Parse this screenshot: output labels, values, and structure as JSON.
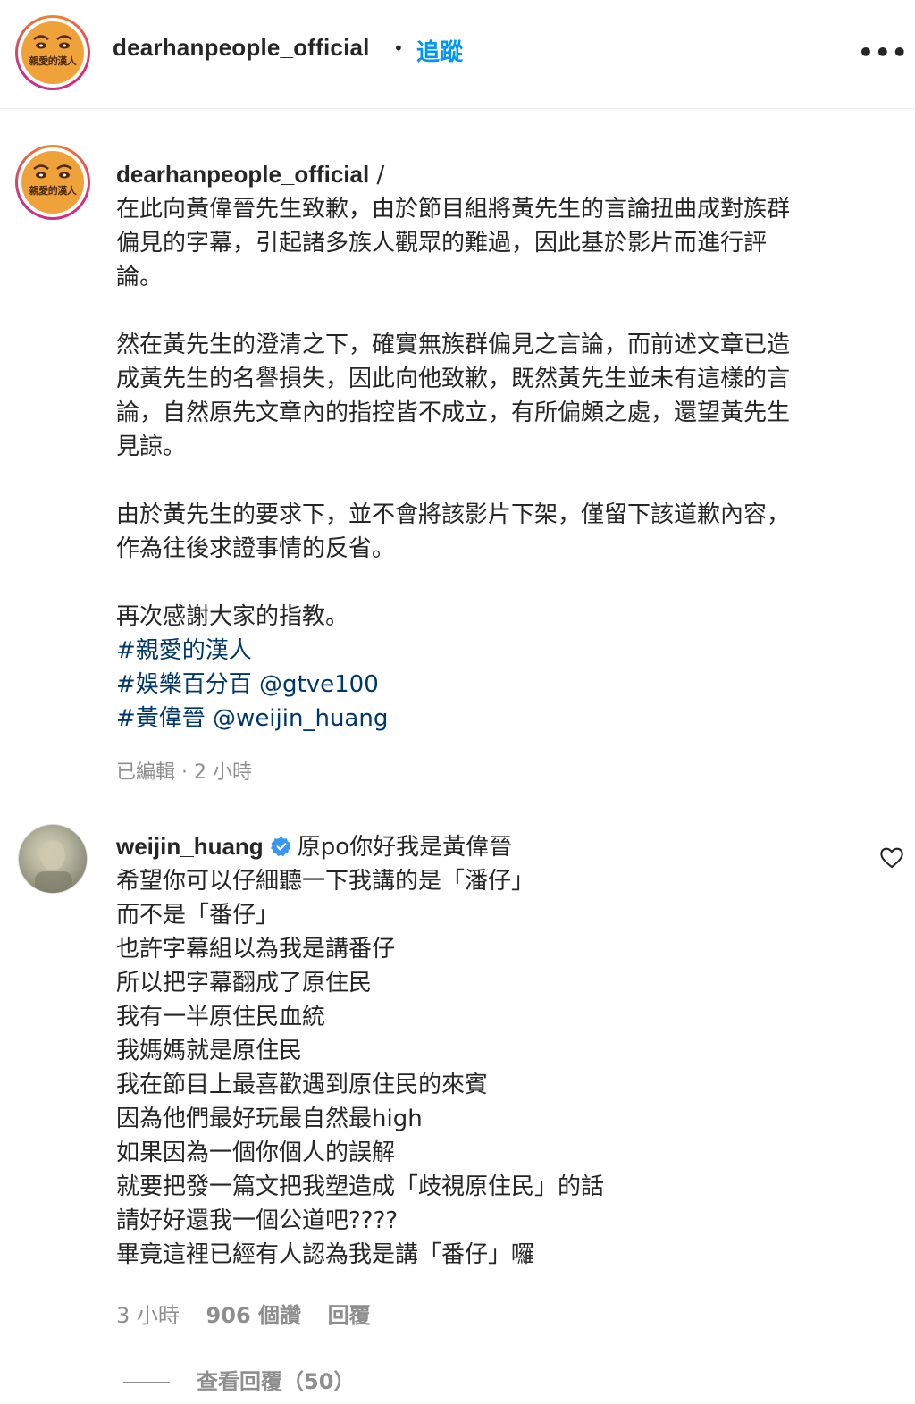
{
  "header": {
    "username": "dearhanpeople_official",
    "separator": "•",
    "follow_label": "追蹤",
    "more_label": "•••",
    "avatar_logo_text": "親愛的漢人"
  },
  "post": {
    "username": "dearhanpeople_official",
    "username_suffix": " /",
    "lines": [
      "在此向黃偉晉先生致歉，由於節目組將黃先生的言論扭曲成對族群",
      "偏見的字幕，引起諸多族人觀眾的難過，因此基於影片而進行評",
      "論。",
      "",
      "然在黃先生的澄清之下，確實無族群偏見之言論，而前述文章已造",
      "成黃先生的名譽損失，因此向他致歉，既然黃先生並未有這樣的言",
      "論，自然原先文章內的指控皆不成立，有所偏頗之處，還望黃先生",
      "見諒。",
      "",
      "由於黃先生的要求下，並不會將該影片下架，僅留下該道歉內容，",
      "作為往後求證事情的反省。",
      "",
      "再次感謝大家的指教。"
    ],
    "hashtags": [
      "#親愛的漢人",
      "#娛樂百分百 @gtve100",
      "#黃偉晉 @weijin_huang"
    ],
    "meta": "已編輯 · 2 小時"
  },
  "comment": {
    "username": "weijin_huang",
    "first_line": "原po你好我是黃偉晉",
    "lines": [
      "希望你可以仔細聽一下我講的是「潘仔」",
      "而不是「番仔」",
      "也許字幕組以為我是講番仔",
      "所以把字幕翻成了原住民",
      "我有一半原住民血統",
      "我媽媽就是原住民",
      "我在節目上最喜歡遇到原住民的來賓",
      "因為他們最好玩最自然最high",
      "如果因為一個你個人的誤解",
      "就要把發一篇文把我塑造成「歧視原住民」的話",
      "請好好還我一個公道吧????",
      "畢竟這裡已經有人認為我是講「番仔」囉"
    ],
    "time": "3 小時",
    "likes": "906 個讚",
    "reply_label": "回覆",
    "view_replies": "查看回覆（50）"
  },
  "colors": {
    "link_blue": "#0095f6",
    "hashtag_navy": "#00376b",
    "meta_gray": "#8e8e8e",
    "verified_blue": "#3897f0"
  }
}
